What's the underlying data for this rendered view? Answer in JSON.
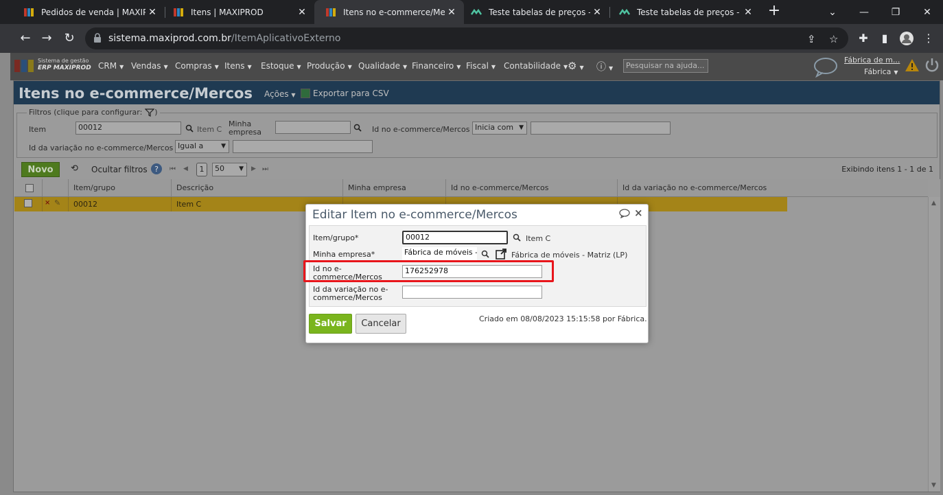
{
  "browser": {
    "tabs": [
      {
        "title": "Pedidos de venda | MAXIPROD",
        "active": false
      },
      {
        "title": "Itens | MAXIPROD",
        "active": false
      },
      {
        "title": "Itens no e-commerce/Mercos",
        "active": true
      },
      {
        "title": "Teste tabelas de preços - MX",
        "active": false
      },
      {
        "title": "Teste tabelas de preços - MX",
        "active": false
      }
    ],
    "url_host": "sistema.maxiprod.com.br",
    "url_path": "/ItemAplicativoExterno"
  },
  "header": {
    "brand_line1": "Sistema de gestão",
    "brand_line2": "ERP MAXIPROD",
    "menu": [
      "CRM",
      "Vendas",
      "Compras",
      "Itens",
      "Estoque",
      "Produção",
      "Qualidade",
      "Financeiro",
      "Fiscal",
      "Contabilidade"
    ],
    "help_placeholder": "Pesquisar na ajuda...",
    "user_name": "Fábrica de m...",
    "user_company": "Fábrica"
  },
  "page": {
    "title": "Itens no e-commerce/Mercos",
    "actions_label": "Ações",
    "export_label": "Exportar para CSV"
  },
  "filters": {
    "legend": "Filtros (clique para configurar:",
    "item_label": "Item",
    "item_value": "00012",
    "item_desc": "Item C",
    "empresa_label": "Minha empresa",
    "ecommerce_label": "Id no e-commerce/Mercos",
    "ecommerce_op": "Inicia com",
    "variacao_label": "Id da variação no e-commerce/Mercos",
    "variacao_op": "Igual a"
  },
  "toolbar": {
    "novo_label": "Novo",
    "hide_filters_label": "Ocultar filtros",
    "page_number": "1",
    "page_size": "50",
    "exibindo": "Exibindo itens 1 - 1 de 1"
  },
  "grid": {
    "columns": [
      "Item/grupo",
      "Descrição",
      "Minha empresa",
      "Id no e-commerce/Mercos",
      "Id da variação no e-commerce/Mercos"
    ],
    "rows": [
      {
        "item": "00012",
        "descricao": "Item C"
      }
    ]
  },
  "dialog": {
    "title": "Editar Item no e-commerce/Mercos",
    "item_label": "Item/grupo*",
    "item_value": "00012",
    "item_desc": "Item C",
    "empresa_label": "Minha empresa*",
    "empresa_value": "Fábrica de móveis - M",
    "empresa_desc": "Fábrica de móveis - Matriz (LP)",
    "ecommerce_label_1": "Id no e-",
    "ecommerce_label_2": "commerce/Mercos",
    "ecommerce_value": "176252978",
    "variacao_label_1": "Id da variação no e-",
    "variacao_label_2": "commerce/Mercos",
    "variacao_value": "",
    "save_label": "Salvar",
    "cancel_label": "Cancelar",
    "created_info": "Criado em 08/08/2023 15:15:58 por Fábrica."
  },
  "colors": {
    "save_button": "#7ab51d",
    "highlight_box": "#e8151b",
    "title_bar": "#1f3a52",
    "selected_row": "#a48418"
  }
}
